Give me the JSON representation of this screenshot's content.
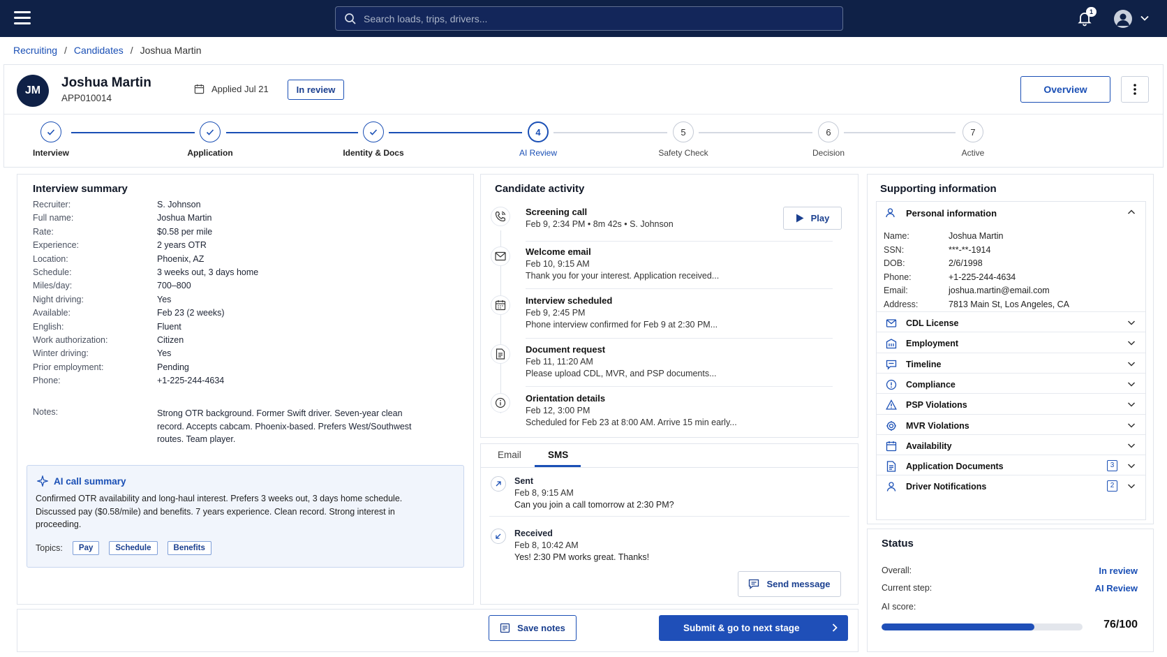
{
  "topbar": {
    "search_placeholder": "Search loads, trips, drivers...",
    "notification_count": "1"
  },
  "breadcrumb": {
    "items": [
      "Recruiting",
      "Candidates"
    ],
    "current": "Joshua Martin"
  },
  "candidate": {
    "initials": "JM",
    "name": "Joshua Martin",
    "id": "APP010014",
    "applied": "Applied Jul 21",
    "status": "In review",
    "overview_label": "Overview"
  },
  "stepper": {
    "steps": [
      {
        "label": "Interview",
        "num": "1",
        "state": "done"
      },
      {
        "label": "Application",
        "num": "2",
        "state": "done"
      },
      {
        "label": "Identity & Docs",
        "num": "3",
        "state": "done"
      },
      {
        "label": "AI Review",
        "num": "4",
        "state": "current"
      },
      {
        "label": "Safety Check",
        "num": "5",
        "state": "todo"
      },
      {
        "label": "Decision",
        "num": "6",
        "state": "todo"
      },
      {
        "label": "Active",
        "num": "7",
        "state": "todo"
      }
    ]
  },
  "interview": {
    "title": "Interview summary",
    "rows": [
      {
        "k": "Recruiter:",
        "v": "S. Johnson"
      },
      {
        "k": "Full name:",
        "v": "Joshua Martin"
      },
      {
        "k": "Rate:",
        "v": "$0.58 per mile"
      },
      {
        "k": "Experience:",
        "v": "2 years OTR"
      },
      {
        "k": "Location:",
        "v": "Phoenix, AZ"
      },
      {
        "k": "Schedule:",
        "v": "3 weeks out, 3 days home"
      },
      {
        "k": "Miles/day:",
        "v": "700–800"
      },
      {
        "k": "Night driving:",
        "v": "Yes"
      },
      {
        "k": "Available:",
        "v": "Feb 23 (2 weeks)"
      },
      {
        "k": "English:",
        "v": "Fluent"
      },
      {
        "k": "Work authorization:",
        "v": "Citizen"
      },
      {
        "k": "Winter driving:",
        "v": "Yes"
      },
      {
        "k": "Prior employment:",
        "v": "Pending"
      },
      {
        "k": "Phone:",
        "v": "+1-225-244-4634"
      }
    ],
    "notes_label": "Notes:",
    "notes_lines": [
      "Strong OTR background. Former Swift driver. Seven-year clean",
      "record. Accepts cabcam. Phoenix-based. Prefers West/Southwest",
      "routes. Team player."
    ],
    "ai": {
      "title": "AI call summary",
      "lines": [
        "Confirmed OTR availability and long-haul interest. Prefers 3 weeks out, 3 days home schedule.",
        "Discussed pay ($0.58/mile) and benefits. 7 years experience. Clean record. Strong interest in",
        "proceeding."
      ],
      "topics_label": "Topics:",
      "topics": [
        "Pay",
        "Schedule",
        "Benefits"
      ]
    }
  },
  "activity": {
    "title": "Candidate activity",
    "play_label": "Play",
    "items": [
      {
        "icon": "phone-icon",
        "title": "Screening call",
        "meta": "Feb 9, 2:34 PM  •  8m 42s  •  S. Johnson",
        "desc": ""
      },
      {
        "icon": "mail-icon",
        "title": "Welcome email",
        "meta": "Feb 10, 9:15 AM",
        "desc": "Thank you for your interest. Application received..."
      },
      {
        "icon": "calendar-icon",
        "title": "Interview scheduled",
        "meta": "Feb 9, 2:45 PM",
        "desc": "Phone interview confirmed for Feb 9 at 2:30 PM..."
      },
      {
        "icon": "document-icon",
        "title": "Document request",
        "meta": "Feb 11, 11:20 AM",
        "desc": "Please upload CDL, MVR, and PSP documents..."
      },
      {
        "icon": "info-icon",
        "title": "Orientation details",
        "meta": "Feb 12, 3:00 PM",
        "desc": "Scheduled for Feb 23 at 8:00 AM. Arrive 15 min early..."
      }
    ]
  },
  "messages": {
    "tabs": [
      "Email",
      "SMS"
    ],
    "active_tab": "SMS",
    "items": [
      {
        "title": "Sent",
        "meta": "Feb 8, 9:15 AM",
        "text": "Can you join a call tomorrow at 2:30 PM?"
      },
      {
        "title": "Received",
        "meta": "Feb 8, 10:42 AM",
        "text": "Yes! 2:30 PM works great. Thanks!"
      }
    ],
    "send_label": "Send message"
  },
  "actions": {
    "save_label": "Save notes",
    "submit_label": "Submit & go to next stage"
  },
  "supporting": {
    "title": "Supporting information",
    "personal_title": "Personal information",
    "personal": [
      {
        "k": "Name:",
        "v": "Joshua Martin"
      },
      {
        "k": "SSN:",
        "v": "***-**-1914"
      },
      {
        "k": "DOB:",
        "v": "2/6/1998"
      },
      {
        "k": "Phone:",
        "v": "+1-225-244-4634"
      },
      {
        "k": "Email:",
        "v": "joshua.martin@email.com"
      },
      {
        "k": "Address:",
        "v": "7813 Main St, Los Angeles, CA"
      }
    ],
    "sections": [
      {
        "label": "CDL License",
        "icon": "license-icon",
        "count": ""
      },
      {
        "label": "Employment",
        "icon": "building-icon",
        "count": ""
      },
      {
        "label": "Timeline",
        "icon": "chat-icon",
        "count": ""
      },
      {
        "label": "Compliance",
        "icon": "alert-circle-icon",
        "count": ""
      },
      {
        "label": "PSP Violations",
        "icon": "warning-icon",
        "count": ""
      },
      {
        "label": "MVR Violations",
        "icon": "badge-icon",
        "count": ""
      },
      {
        "label": "Availability",
        "icon": "calendar-icon",
        "count": ""
      },
      {
        "label": "Application Documents",
        "icon": "document-icon",
        "count": "3"
      },
      {
        "label": "Driver Notifications",
        "icon": "person-icon",
        "count": "2"
      }
    ]
  },
  "status": {
    "title": "Status",
    "overall_label": "Overall:",
    "overall_value": "In review",
    "step_label": "Current step:",
    "step_value": "AI Review",
    "score_label": "AI score:",
    "score": "76/100",
    "score_fraction": 0.76
  },
  "colors": {
    "navy": "#0f2147",
    "accent": "#1a4fb5"
  }
}
